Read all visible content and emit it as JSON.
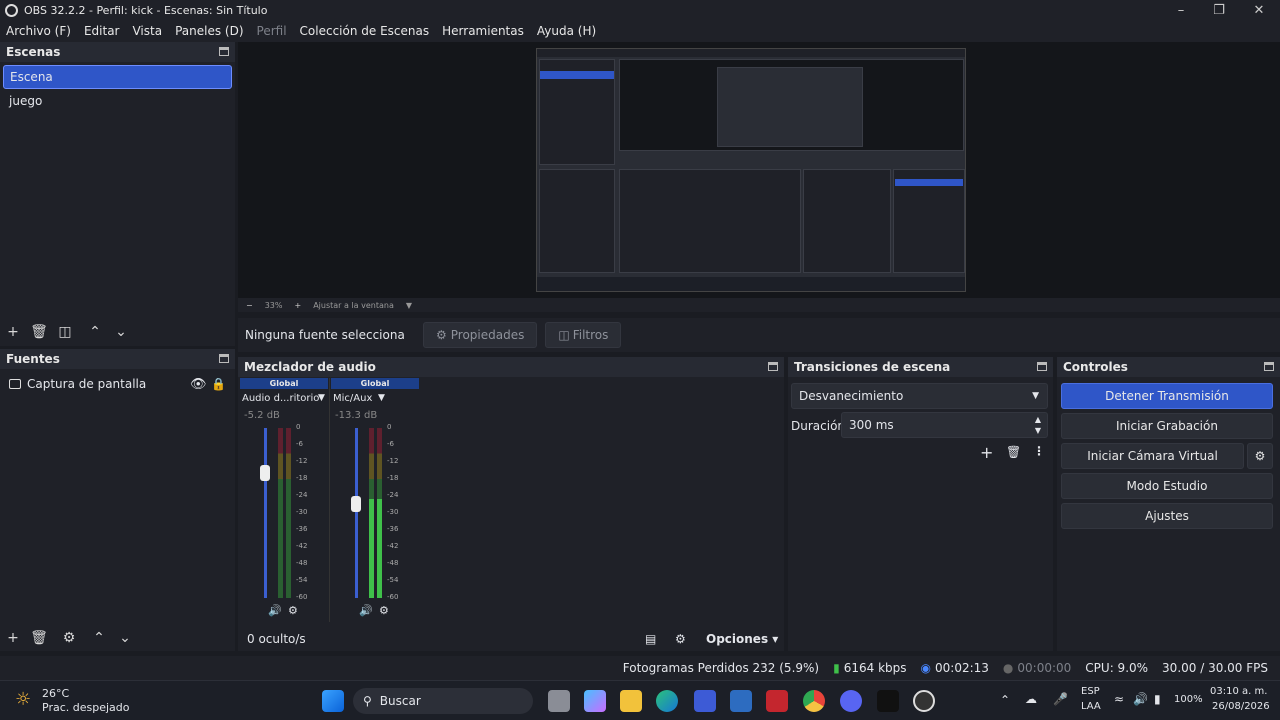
{
  "window": {
    "title": "OBS 32.2.2 - Perfil: kick - Escenas: Sin Título"
  },
  "menu": [
    "Archivo (F)",
    "Editar",
    "Vista",
    "Paneles (D)",
    "Perfil",
    "Colección de Escenas",
    "Herramientas",
    "Ayuda (H)"
  ],
  "preview": {
    "zoom": "33%",
    "fit_label": "Ajustar a la ventana"
  },
  "source_bar": {
    "status": "Ninguna fuente selecciona",
    "properties": "Propiedades",
    "filters": "Filtros"
  },
  "scenes": {
    "title": "Escenas",
    "items": [
      "Escena",
      "juego"
    ],
    "selected": 0
  },
  "sources": {
    "title": "Fuentes",
    "items": [
      {
        "name": "Captura de pantalla"
      }
    ]
  },
  "mixer": {
    "title": "Mezclador de audio",
    "tracks": [
      {
        "header": "Global",
        "name": "Audio d...ritorio",
        "db": "-5.2 dB",
        "volume": 0.78,
        "level": 0.0
      },
      {
        "header": "Global",
        "name": "Mic/Aux",
        "db": "-13.3 dB",
        "volume": 0.6,
        "level": 0.58
      }
    ],
    "scale": [
      "0",
      "-6",
      "-12",
      "-18",
      "-24",
      "-30",
      "-36",
      "-42",
      "-48",
      "-54",
      "-60"
    ],
    "hidden": "0 oculto/s",
    "options": "Opciones"
  },
  "transitions": {
    "title": "Transiciones de escena",
    "selected": "Desvanecimiento",
    "duration_label": "Duración",
    "duration_value": "300 ms"
  },
  "controls": {
    "title": "Controles",
    "stop_stream": "Detener Transmisión",
    "start_record": "Iniciar Grabación",
    "virtual_cam": "Iniciar Cámara Virtual",
    "studio_mode": "Modo Estudio",
    "settings": "Ajustes"
  },
  "status": {
    "dropped": "Fotogramas Perdidos 232 (5.9%)",
    "kbps": "6164 kbps",
    "stream_time": "00:02:13",
    "rec_time": "00:00:00",
    "cpu": "CPU: 9.0%",
    "fps": "30.00 / 30.00 FPS"
  },
  "taskbar": {
    "weather_temp": "26°C",
    "weather_desc": "Prac. despejado",
    "search": "Buscar",
    "lang1": "ESP",
    "lang2": "LAA",
    "battery": "100%",
    "time": "03:10 a. m.",
    "date": "26/08/2026"
  },
  "colors": {
    "accent": "#2f56c8",
    "panel": "#1f2128",
    "meter_green": "#3fc04a",
    "meter_yellow": "#c9b23a",
    "meter_red": "#b0303a"
  }
}
